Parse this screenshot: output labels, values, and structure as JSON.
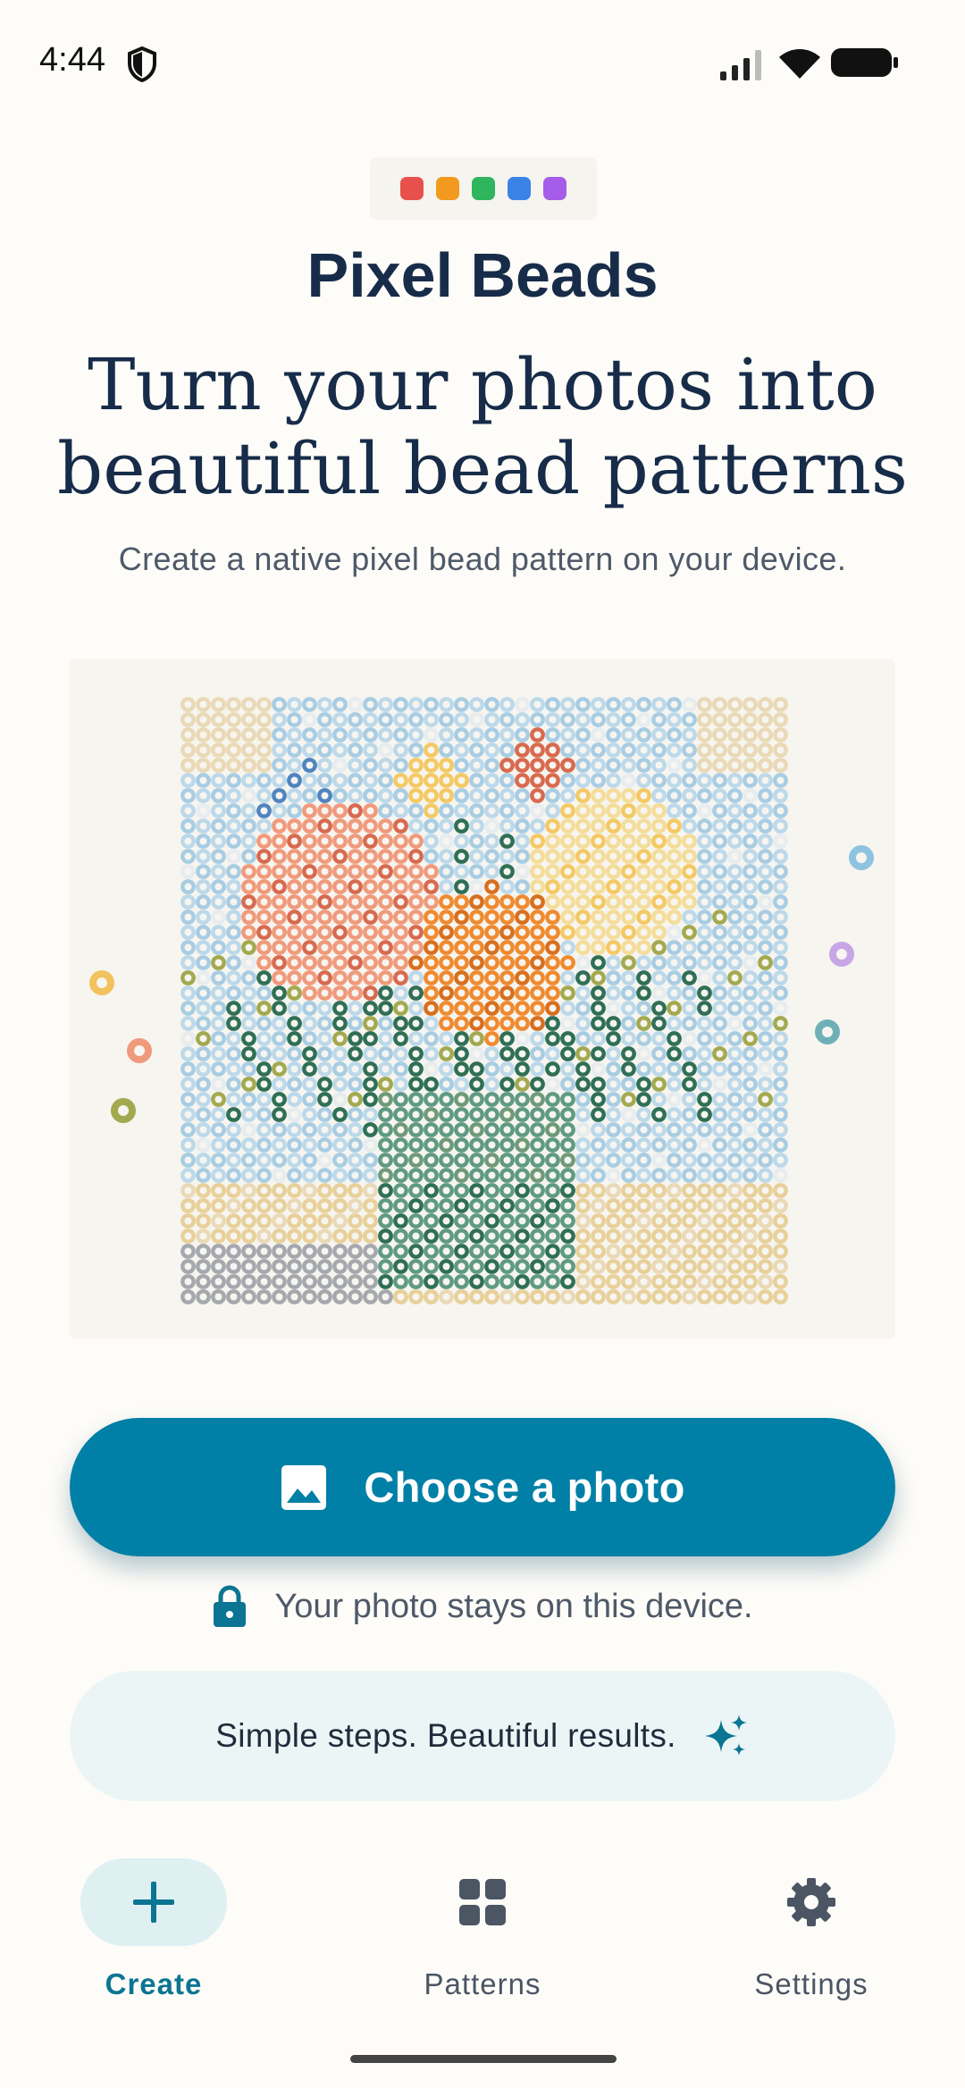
{
  "status_bar": {
    "time": "4:44"
  },
  "brand": {
    "dot_colors": [
      "#e8504b",
      "#f29a1f",
      "#2eb55e",
      "#3b82e6",
      "#a55ce8"
    ]
  },
  "header": {
    "app_title": "Pixel Beads",
    "headline": "Turn your photos into beautiful bead patterns",
    "subtitle": "Create a native pixel bead pattern on your device."
  },
  "hero": {
    "illustration": "bead-flower-vase-image"
  },
  "actions": {
    "choose_photo_label": "Choose a photo",
    "choose_photo_icon": "image-icon"
  },
  "privacy": {
    "text": "Your photo stays on this device.",
    "icon": "lock-icon"
  },
  "tip": {
    "text": "Simple steps. Beautiful results.",
    "icon": "sparkle-icon"
  },
  "bottom_nav": {
    "items": [
      {
        "label": "Create",
        "icon": "plus-icon",
        "active": true
      },
      {
        "label": "Patterns",
        "icon": "grid-icon",
        "active": false
      },
      {
        "label": "Settings",
        "icon": "gear-icon",
        "active": false
      }
    ]
  },
  "colors": {
    "accent": "#0080a6",
    "background": "#fdfcf8",
    "title": "#172c49",
    "tip_background": "#ecf5f6"
  }
}
